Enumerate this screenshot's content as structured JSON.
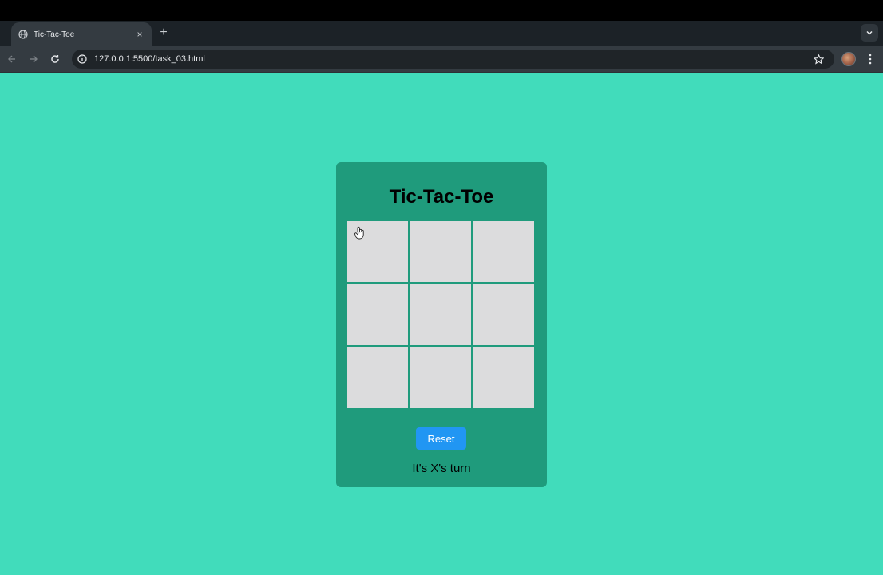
{
  "browser": {
    "tab_title": "Tic-Tac-Toe",
    "tab_close_glyph": "×",
    "new_tab_glyph": "+",
    "url": "127.0.0.1:5500/task_03.html",
    "icons": [
      "globe-icon",
      "close-icon",
      "plus-icon",
      "chevron-down-icon",
      "back-arrow-icon",
      "forward-arrow-icon",
      "reload-icon",
      "info-icon",
      "star-icon",
      "kebab-menu-icon"
    ]
  },
  "game": {
    "title": "Tic-Tac-Toe",
    "cells": [
      "",
      "",
      "",
      "",
      "",
      "",
      "",
      "",
      ""
    ],
    "reset_label": "Reset",
    "status": "It's X's turn"
  },
  "colors": {
    "page_background": "#41dcbb",
    "card_background": "#1f9b7c",
    "cell_background": "#dcdcdd",
    "reset_button": "#2196f3"
  }
}
